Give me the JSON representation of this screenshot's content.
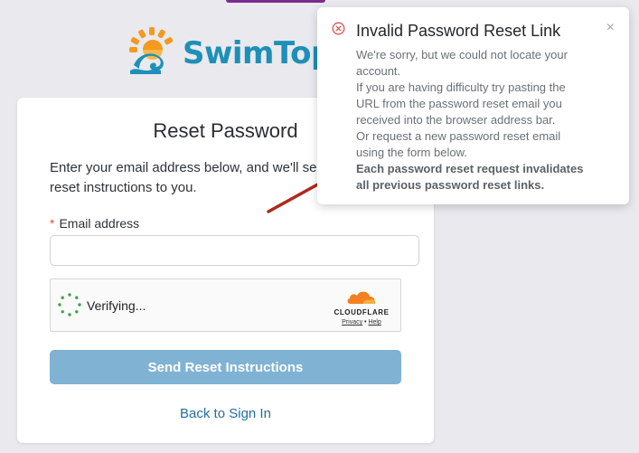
{
  "logo": {
    "text": "SwimTopia"
  },
  "card": {
    "title": "Reset Password",
    "description": "Enter your email address below, and we'll send reset instructions to you.",
    "email_label": "Email address",
    "required_mark": "*",
    "email_value": "",
    "email_placeholder": "",
    "captcha": {
      "status": "Verifying...",
      "brand": "CLOUDFLARE",
      "privacy": "Privacy",
      "separator": "•",
      "help": "Help"
    },
    "submit_label": "Send Reset Instructions",
    "back_link": "Back to Sign In"
  },
  "toast": {
    "title": "Invalid Password Reset Link",
    "lines": [
      "We're sorry, but we could not locate your account.",
      "If you are having difficulty try pasting the URL from the password reset email you received into the browser address bar.",
      "Or request a new password reset email using the form below."
    ],
    "bold_text": "Each password reset request invalidates all previous password reset links.",
    "close": "×",
    "icon": "error-circle-icon"
  },
  "colors": {
    "background": "#e9e9ee",
    "brand_blue": "#1e8fb8",
    "brand_orange": "#f39a1e",
    "button": "#7fb2d3",
    "link": "#1f6fa0",
    "error": "#d9534f",
    "arrow": "#b0271c"
  }
}
